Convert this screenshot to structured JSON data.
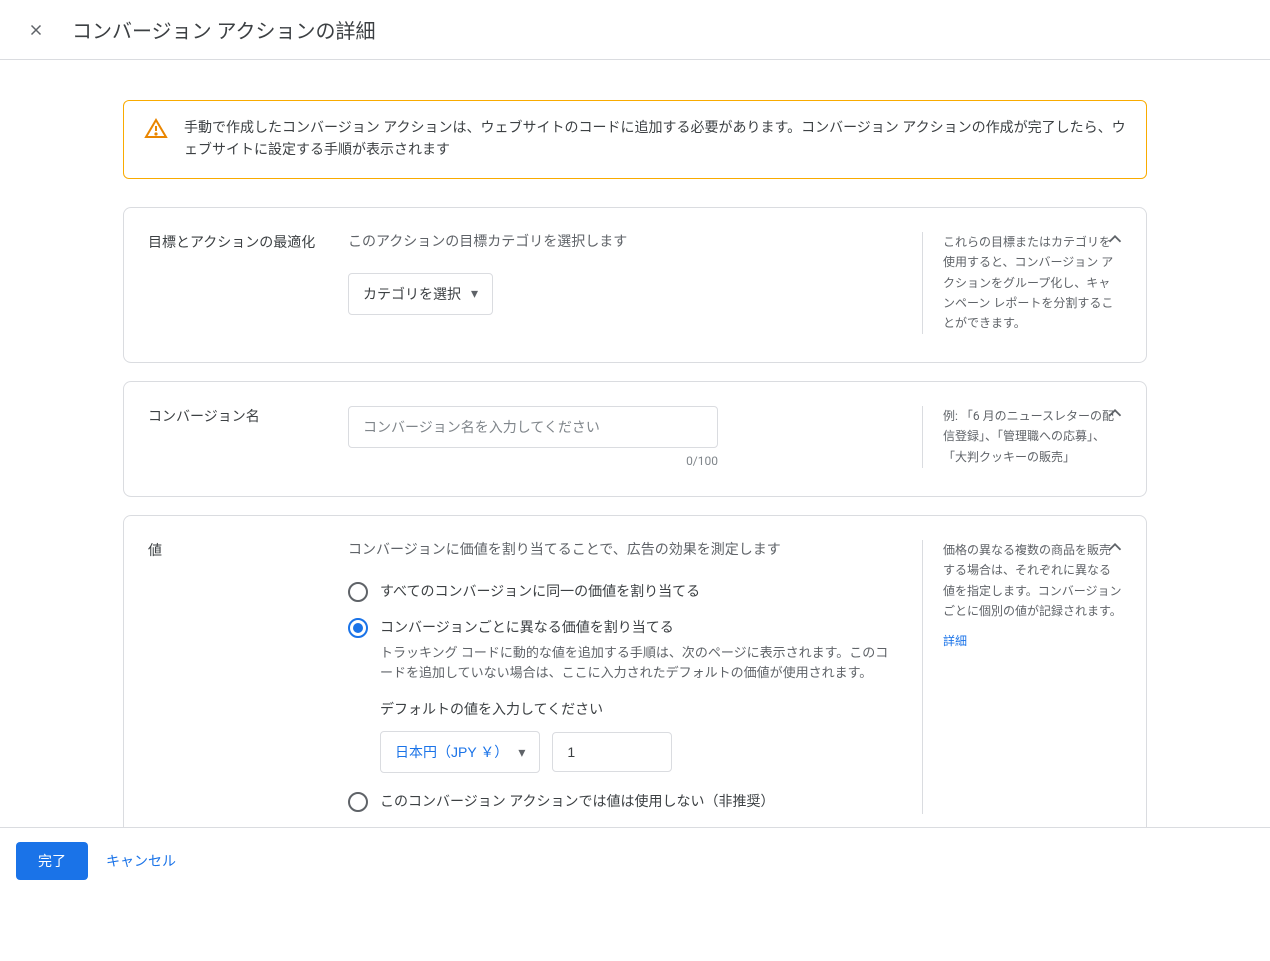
{
  "header": {
    "title": "コンバージョン アクションの詳細"
  },
  "alert": {
    "text": "手動で作成したコンバージョン アクションは、ウェブサイトのコードに追加する必要があります。コンバージョン アクションの作成が完了したら、ウェブサイトに設定する手順が表示されます"
  },
  "section1": {
    "label": "目標とアクションの最適化",
    "desc": "このアクションの目標カテゴリを選択します",
    "select_label": "カテゴリを選択",
    "side": "これらの目標またはカテゴリを使用すると、コンバージョン アクションをグループ化し、キャンペーン レポートを分割することができます。"
  },
  "section2": {
    "label": "コンバージョン名",
    "placeholder": "コンバージョン名を入力してください",
    "value": "",
    "char_count": "0/100",
    "side": "例: 「6 月のニュースレターの配信登録」、「管理職への応募」、「大判クッキーの販売」"
  },
  "section3": {
    "label": "値",
    "desc": "コンバージョンに価値を割り当てることで、広告の効果を測定します",
    "opt_same": "すべてのコンバージョンに同一の価値を割り当てる",
    "opt_diff": "コンバージョンごとに異なる価値を割り当てる",
    "opt_diff_sub": "トラッキング コードに動的な値を追加する手順は、次のページに表示されます。このコードを追加していない場合は、ここに入力されたデフォルトの価値が使用されます。",
    "default_label": "デフォルトの値を入力してください",
    "currency": "日本円（JPY ￥）",
    "amount": "1",
    "opt_none": "このコンバージョン アクションでは値は使用しない（非推奨）",
    "side": "価格の異なる複数の商品を販売する場合は、それぞれに異なる値を指定します。コンバージョンごとに個別の値が記録されます。",
    "side_link": "詳細"
  },
  "footer": {
    "done": "完了",
    "cancel": "キャンセル"
  }
}
